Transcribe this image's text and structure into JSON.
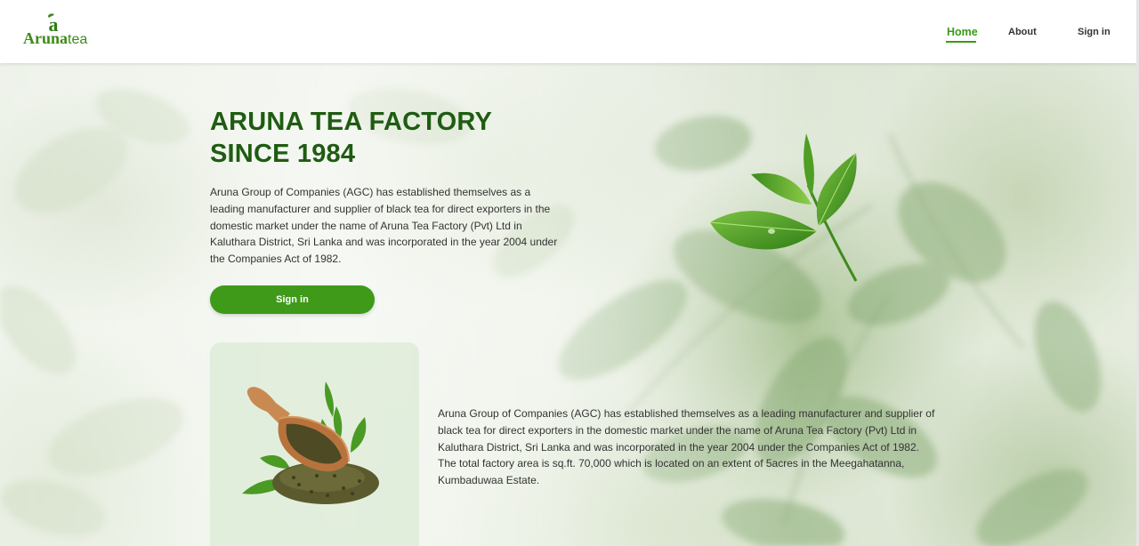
{
  "brand": {
    "logo_mark": "a",
    "name_primary": "Aruna",
    "name_secondary": "tea",
    "color": "#3c8b1a"
  },
  "nav": {
    "home": "Home",
    "about": "About",
    "sign_in": "Sign in",
    "active": "Home",
    "active_color": "#3a9a1a"
  },
  "hero": {
    "title_line1": "ARUNA TEA FACTORY",
    "title_line2": "SINCE 1984",
    "description": "Aruna Group of Companies (AGC) has established themselves as a leading manufacturer and supplier of black tea for direct exporters in the domestic market under the name of Aruna Tea Factory (Pvt) Ltd in Kaluthara District, Sri Lanka and was incorporated in the year 2004 under the Companies Act of 1982.",
    "button_label": "Sign in",
    "title_color": "#1f5c12",
    "button_color": "#3f9a1a"
  },
  "about": {
    "description": "Aruna Group of Companies (AGC) has established themselves as a leading manufacturer and supplier of black tea for direct exporters in the domestic market under the name of Aruna Tea Factory (Pvt) Ltd in Kaluthara District, Sri Lanka and was incorporated in the year 2004 under the Companies Act of 1982. The total factory area is sq.ft. 70,000 which is located on an extent of 5acres in the Meegahatanna, Kumbaduwaa Estate."
  },
  "icons": {
    "hero_image": "tea-leaf-sprig-icon",
    "card_image": "tea-scoop-icon"
  }
}
